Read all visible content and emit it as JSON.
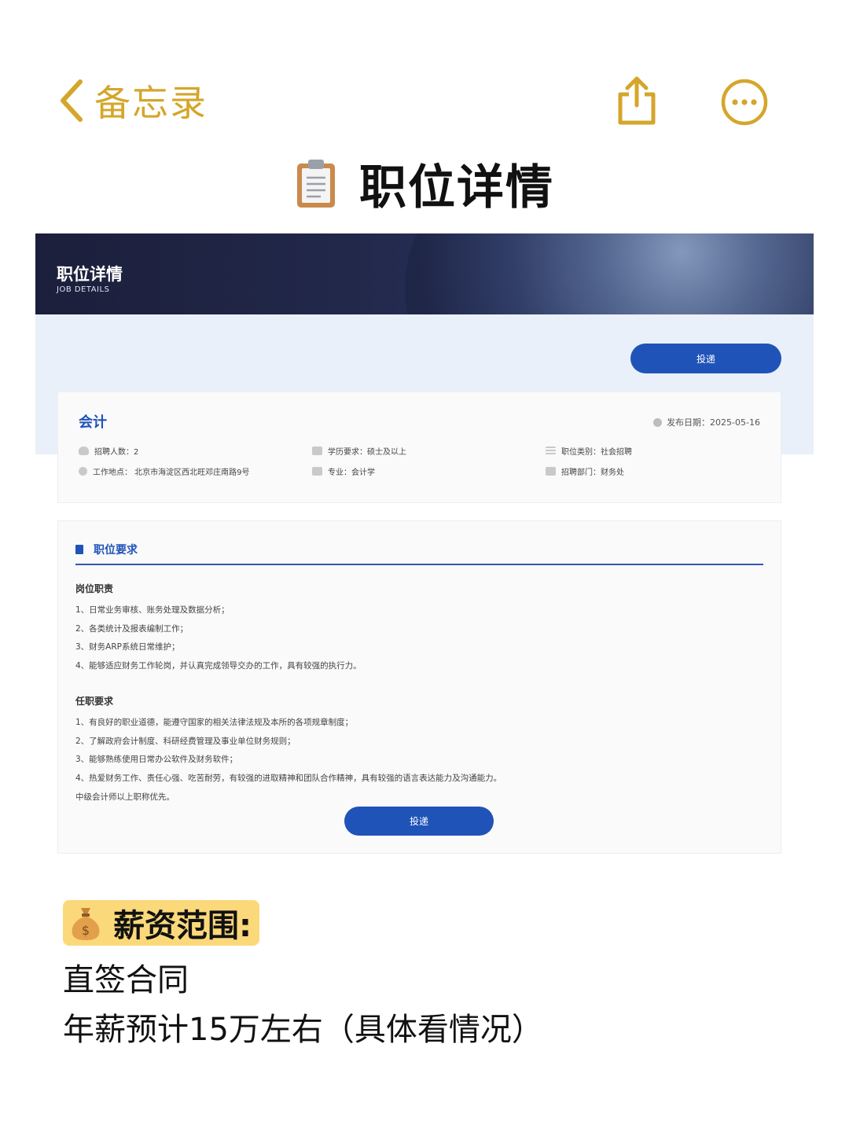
{
  "topbar": {
    "back_label": "备忘录",
    "accent_color": "#d4a62a",
    "share_icon": "share-icon",
    "more_icon": "more-icon"
  },
  "note": {
    "title_icon": "clipboard-icon",
    "title": "职位详情"
  },
  "screenshot": {
    "banner_title": "职位详情",
    "banner_subtitle": "JOB DETAILS",
    "apply_button": "投递",
    "job": {
      "name": "会计",
      "publish_date": "发布日期：2025-05-16",
      "info": [
        {
          "icon": "person-icon",
          "text": "招聘人数：2"
        },
        {
          "icon": "graduation-cap-icon",
          "text": "学历要求：硕士及以上"
        },
        {
          "icon": "list-icon",
          "text": "职位类别：社会招聘"
        },
        {
          "icon": "location-pin-icon",
          "text": "工作地点：  北京市海淀区西北旺邓庄南路9号"
        },
        {
          "icon": "book-icon",
          "text": "专业：会计学"
        },
        {
          "icon": "building-icon",
          "text": "招聘部门：财务处"
        }
      ]
    },
    "requirements": {
      "heading": "职位要求",
      "duties_title": "岗位职责",
      "duties": [
        "1、日常业务审核、账务处理及数据分析；",
        "2、各类统计及报表编制工作；",
        "3、财务ARP系统日常维护；",
        "4、能够适应财务工作轮岗，并认真完成领导交办的工作，具有较强的执行力。"
      ],
      "qualifications_title": "任职要求",
      "qualifications": [
        "1、有良好的职业道德，能遵守国家的相关法律法规及本所的各项规章制度；",
        "2、了解政府会计制度、科研经费管理及事业单位财务规则；",
        "3、能够熟练使用日常办公软件及财务软件；",
        "4、热爱财务工作、责任心强、吃苦耐劳，有较强的进取精神和团队合作精神，具有较强的语言表达能力及沟通能力。",
        "中级会计师以上职称优先。"
      ],
      "apply_button": "投递"
    },
    "brand_color": "#1f53b8"
  },
  "salary": {
    "icon": "money-bag-icon",
    "title": "薪资范围:",
    "highlight_color": "#fbd97a",
    "lines": [
      "直签合同",
      "年薪预计15万左右（具体看情况）"
    ]
  }
}
